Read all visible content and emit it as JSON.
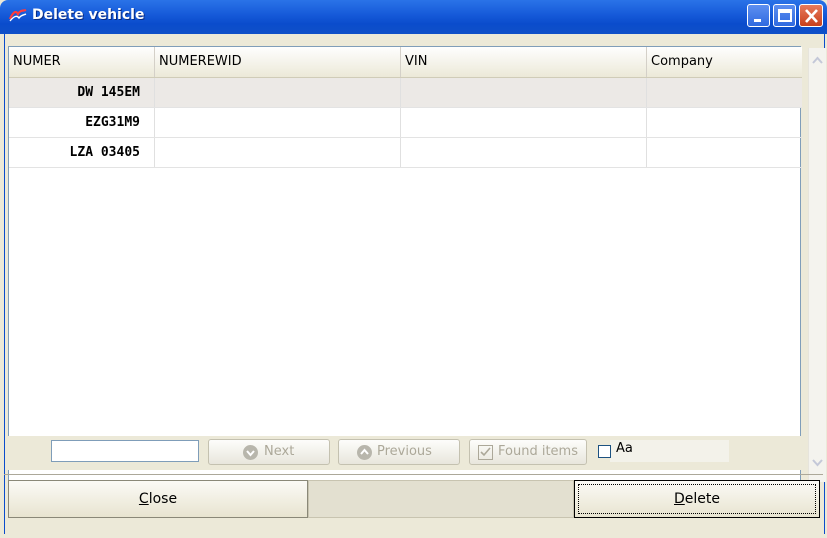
{
  "window": {
    "title": "Delete vehicle"
  },
  "grid": {
    "columns": [
      "NUMER",
      "NUMEREWID",
      "VIN",
      "Company"
    ],
    "rows": [
      {
        "numer": "DW 145EM",
        "numerewid": "",
        "vin": "",
        "company": ""
      },
      {
        "numer": "EZG31M9",
        "numerewid": "",
        "vin": "",
        "company": ""
      },
      {
        "numer": "LZA 03405",
        "numerewid": "",
        "vin": "",
        "company": ""
      }
    ]
  },
  "search": {
    "value": "",
    "next_label": "Next",
    "previous_label": "Previous",
    "found_label": "Found items",
    "case_label": "Aa"
  },
  "buttons": {
    "close_prefix": "C",
    "close_rest": "lose",
    "delete_prefix": "D",
    "delete_rest": "elete"
  },
  "colors": {
    "titlebar": "#0a4ccc",
    "selected_row": "#ece9e6"
  }
}
